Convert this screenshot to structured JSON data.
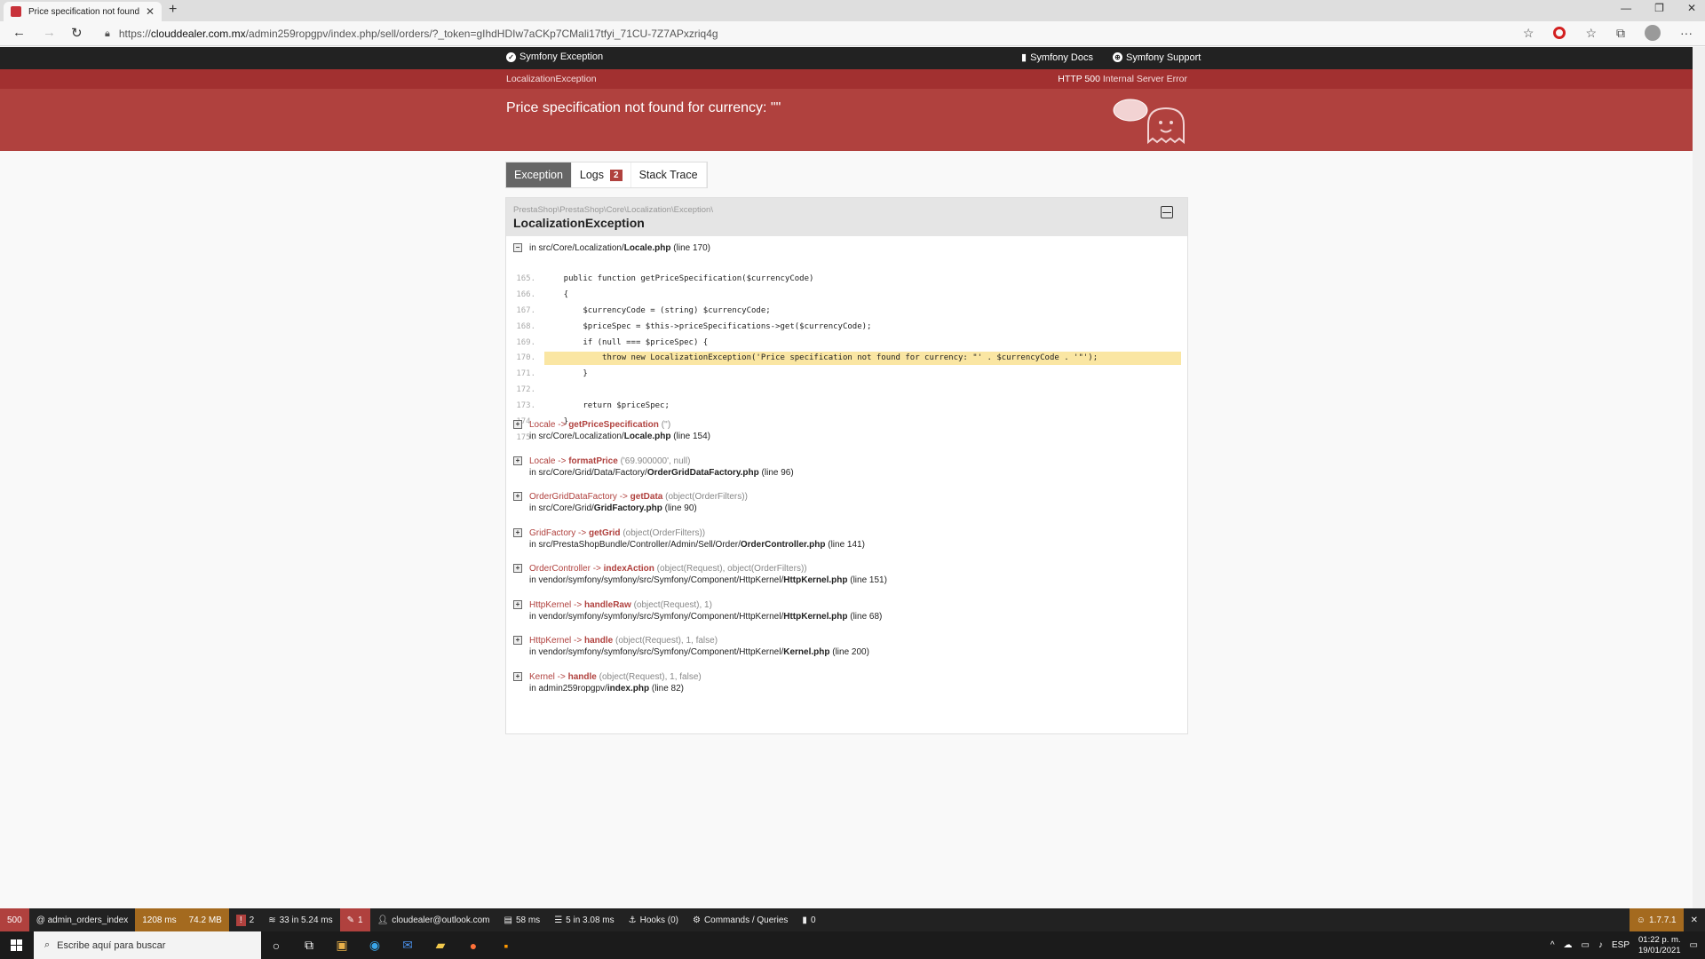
{
  "browser": {
    "tab_title": "Price specification not found fo",
    "url_prefix": "https://",
    "url_domain": "clouddealer.com.mx",
    "url_path": "/admin259ropgpv/index.php/sell/orders/?_token=gIhdHDIw7aCKp7CMali17tfyi_71CU-7Z7APxzriq4g"
  },
  "sf_header": {
    "brand": "Symfony Exception",
    "docs": "Symfony Docs",
    "support": "Symfony Support"
  },
  "exception": {
    "class_short": "LocalizationException",
    "status_code": "HTTP 500",
    "status_text": "Internal Server Error",
    "message": "Price specification not found for currency: \"\"",
    "namespace": "PrestaShop\\PrestaShop\\Core\\Localization\\Exception\\",
    "name": "LocalizationException",
    "location_prefix": "in src/Core/Localization/",
    "location_file": "Locale.php",
    "location_line": "(line 170)"
  },
  "tabs": {
    "exception": "Exception",
    "logs": "Logs",
    "logs_count": "2",
    "stack": "Stack Trace"
  },
  "code_lines": [
    {
      "n": "165.",
      "t": "    public function getPriceSpecification($currencyCode)"
    },
    {
      "n": "166.",
      "t": "    {"
    },
    {
      "n": "167.",
      "t": "        $currencyCode = (string) $currencyCode;"
    },
    {
      "n": "168.",
      "t": "        $priceSpec = $this->priceSpecifications->get($currencyCode);"
    },
    {
      "n": "169.",
      "t": "        if (null === $priceSpec) {"
    },
    {
      "n": "170.",
      "t": "            throw new LocalizationException('Price specification not found for currency: \"' . $currencyCode . '\"');"
    },
    {
      "n": "171.",
      "t": "        }"
    },
    {
      "n": "172.",
      "t": ""
    },
    {
      "n": "173.",
      "t": "        return $priceSpec;"
    },
    {
      "n": "174.",
      "t": "    }"
    },
    {
      "n": "175.",
      "t": ""
    }
  ],
  "trace": [
    {
      "cls": "Locale",
      "fn": "getPriceSpecification",
      "args": "('')",
      "path": "in src/Core/Localization/",
      "file": "Locale.php",
      "line": "(line 154)"
    },
    {
      "cls": "Locale",
      "fn": "formatPrice",
      "args": "('69.900000', null)",
      "path": "in src/Core/Grid/Data/Factory/",
      "file": "OrderGridDataFactory.php",
      "line": "(line 96)"
    },
    {
      "cls": "OrderGridDataFactory",
      "fn": "getData",
      "args": "(object(OrderFilters))",
      "path": "in src/Core/Grid/",
      "file": "GridFactory.php",
      "line": "(line 90)"
    },
    {
      "cls": "GridFactory",
      "fn": "getGrid",
      "args": "(object(OrderFilters))",
      "path": "in src/PrestaShopBundle/Controller/Admin/Sell/Order/",
      "file": "OrderController.php",
      "line": "(line 141)"
    },
    {
      "cls": "OrderController",
      "fn": "indexAction",
      "args": "(object(Request), object(OrderFilters))",
      "path": "in vendor/symfony/symfony/src/Symfony/Component/HttpKernel/",
      "file": "HttpKernel.php",
      "line": "(line 151)"
    },
    {
      "cls": "HttpKernel",
      "fn": "handleRaw",
      "args": "(object(Request), 1)",
      "path": "in vendor/symfony/symfony/src/Symfony/Component/HttpKernel/",
      "file": "HttpKernel.php",
      "line": "(line 68)"
    },
    {
      "cls": "HttpKernel",
      "fn": "handle",
      "args": "(object(Request), 1, false)",
      "path": "in vendor/symfony/symfony/src/Symfony/Component/HttpKernel/",
      "file": "Kernel.php",
      "line": "(line 200)"
    },
    {
      "cls": "Kernel",
      "fn": "handle",
      "args": "(object(Request), 1, false)",
      "path": "in admin259ropgpv/",
      "file": "index.php",
      "line": "(line 82)"
    }
  ],
  "toolbar": {
    "status": "500",
    "route": "@ admin_orders_index",
    "time": "1208 ms",
    "memory": "74.2 MB",
    "errors": "2",
    "cache": "33 in 5.24 ms",
    "logs": "1",
    "user": "cloudealer@outlook.com",
    "render": "58 ms",
    "db": "5 in 3.08 ms",
    "hooks": "Hooks (0)",
    "commands": "Commands / Queries",
    "events": "0",
    "version": "1.7.7.1"
  },
  "taskbar": {
    "search_placeholder": "Escribe aquí para buscar",
    "lang": "ESP",
    "time": "01:22 p. m.",
    "date": "19/01/2021"
  }
}
